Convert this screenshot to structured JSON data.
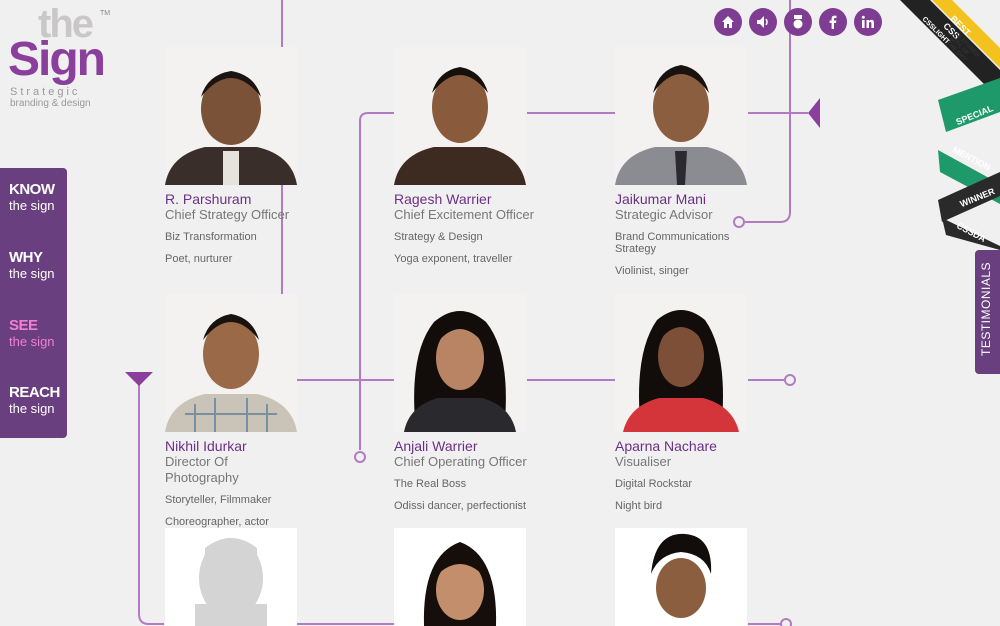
{
  "logo": {
    "the": "the",
    "sign": "Sign",
    "tm": "TM",
    "tagline1": "Strategic",
    "tagline2": "branding & design"
  },
  "nav": [
    {
      "key": "KNOW",
      "sub": "the sign",
      "active": false
    },
    {
      "key": "WHY",
      "sub": "the sign",
      "active": false
    },
    {
      "key": "SEE",
      "sub": "the sign",
      "active": true
    },
    {
      "key": "REACH",
      "sub": "the sign",
      "active": false
    }
  ],
  "social_icons": [
    "home-icon",
    "speaker-icon",
    "award-icon",
    "facebook-icon",
    "linkedin-icon"
  ],
  "people": [
    {
      "name": "R. Parshuram",
      "title": "Chief Strategy Officer",
      "line1": "Biz Transformation",
      "line2": "Poet, nurturer"
    },
    {
      "name": "Ragesh Warrier",
      "title": "Chief Excitement Officer",
      "line1": "Strategy & Design",
      "line2": "Yoga exponent, traveller"
    },
    {
      "name": "Jaikumar Mani",
      "title": "Strategic Advisor",
      "line1": "Brand Communications Strategy",
      "line2": "Violinist, singer"
    },
    {
      "name": "Nikhil Idurkar",
      "title": "Director Of Photography",
      "line1": "Storyteller, Filmmaker",
      "line2": "Choreographer, actor"
    },
    {
      "name": "Anjali Warrier",
      "title": "Chief Operating Officer",
      "line1": "The Real Boss",
      "line2": "Odissi dancer, perfectionist"
    },
    {
      "name": "Aparna Nachare",
      "title": "Visualiser",
      "line1": "Digital Rockstar",
      "line2": "Night bird"
    }
  ],
  "ribbons": {
    "best_css": "BEST CSS",
    "cssllight": "CSSLIGHT",
    "featured": "FEATURED SITE OF THE DAY",
    "special": "SPECIAL",
    "mention": "MENTION",
    "winner": "WINNER",
    "cssda": "CSSDA"
  },
  "testimonials_label": "TESTIMONIALS",
  "colors": {
    "accent": "#7e3d93",
    "nav_bg": "#6a3f7f",
    "active_nav": "#f27fd0",
    "line": "#b37ac4"
  }
}
